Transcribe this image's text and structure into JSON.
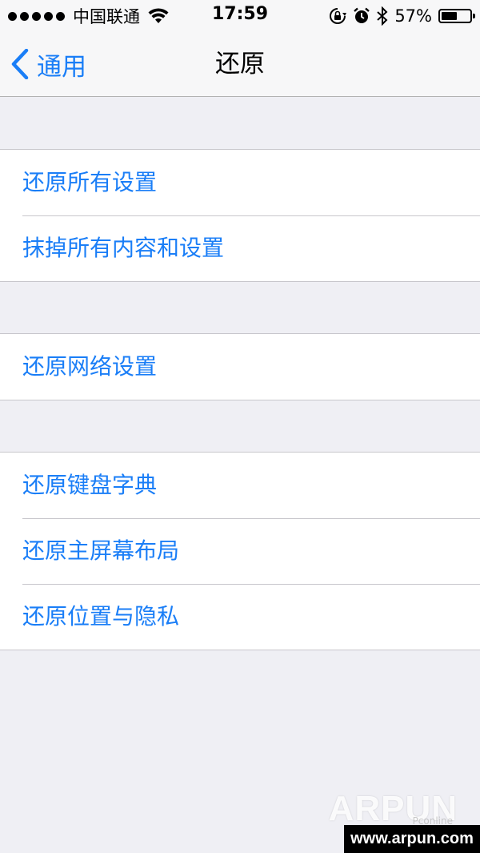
{
  "status_bar": {
    "signal_dots": 5,
    "carrier": "中国联通",
    "time": "17:59",
    "battery_percent_text": "57%",
    "battery_level": 0.57,
    "icons": [
      "wifi-icon",
      "rotation-lock-icon",
      "alarm-icon",
      "bluetooth-icon",
      "battery-icon"
    ]
  },
  "nav": {
    "back_label": "通用",
    "title": "还原"
  },
  "groups": [
    {
      "items": [
        {
          "label": "还原所有设置"
        },
        {
          "label": "抹掉所有内容和设置"
        }
      ]
    },
    {
      "items": [
        {
          "label": "还原网络设置"
        }
      ]
    },
    {
      "items": [
        {
          "label": "还原键盘字典"
        },
        {
          "label": "还原主屏幕布局"
        },
        {
          "label": "还原位置与隐私"
        }
      ]
    }
  ],
  "watermark": {
    "logo": "ARPUN",
    "sub": "Pconline",
    "url": "www.arpun.com"
  },
  "colors": {
    "accent": "#1a7ef7",
    "background": "#efeff4",
    "bar": "#f7f7f8",
    "separator": "#c8c7cc"
  }
}
